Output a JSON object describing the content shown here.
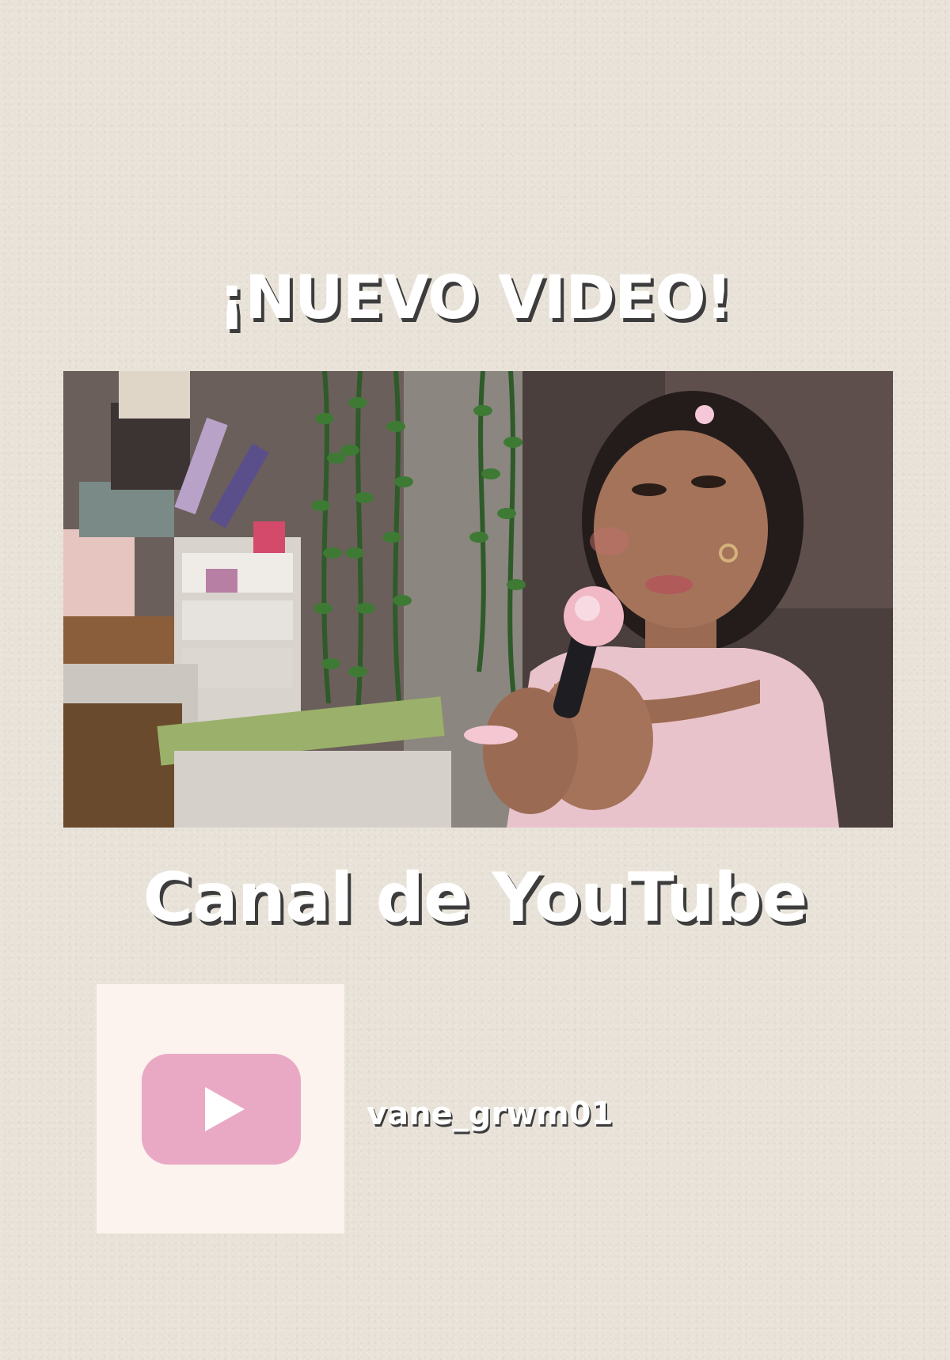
{
  "headline": "¡NUEVO VIDEO!",
  "channel_title": "Canal de YouTube",
  "handle": "vane_grwm01",
  "youtube_icon": {
    "name": "youtube-play-icon",
    "color": "#e9a9c4"
  },
  "thumbnail": {
    "name": "video-thumbnail"
  },
  "colors": {
    "background": "#e8e2d8",
    "text": "#ffffff",
    "text_shadow": "#3c3c3c",
    "card": "#fcf3ee"
  }
}
